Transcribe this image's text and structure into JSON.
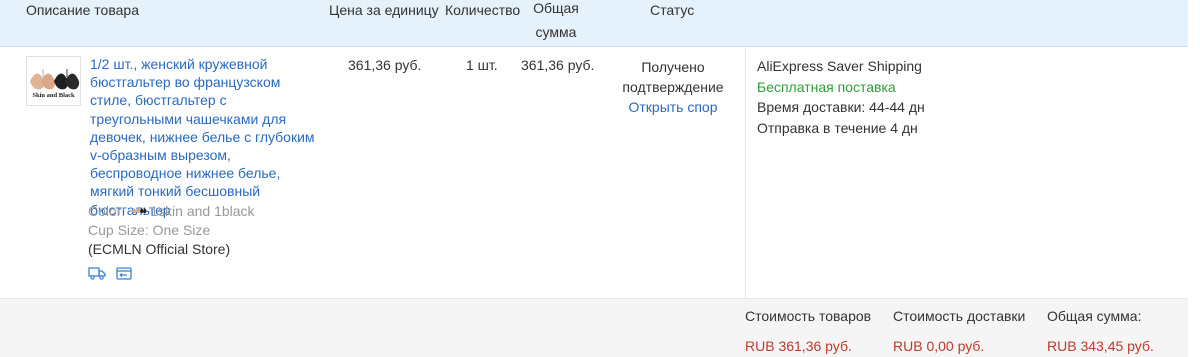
{
  "header": {
    "description": "Описание товара",
    "unit_price": "Цена за единицу",
    "quantity": "Количество",
    "total": "Общая сумма",
    "status": "Статус"
  },
  "product": {
    "thumbnail_brand": "Skin and Black",
    "title": "1/2 шт., женский кружевной бюстгальтер во французском стиле, бюстгальтер с треугольными чашечками для девочек, нижнее белье с глубоким v-образным вырезом, беспроводное нижнее белье, мягкий тонкий бесшовный бюстгальтер",
    "color_label": "Color:",
    "color_value": "1skin and 1black",
    "cup_label": "Cup Size:",
    "cup_value": "One Size",
    "store": "(ECMLN Official Store)",
    "icons": [
      "delivery-truck-icon",
      "store-card-icon"
    ]
  },
  "row": {
    "price": "361,36 руб.",
    "quantity": "1 шт.",
    "total": "361,36 руб.",
    "status_line1": "Получено",
    "status_line2": "подтверждение",
    "dispute_link": "Открыть спор"
  },
  "shipping": {
    "method": "AliExpress Saver Shipping",
    "free": "Бесплатная поставка",
    "delivery_time": "Время доставки: 44-44 дн",
    "dispatch": "Отправка в течение 4 дн"
  },
  "summary": {
    "goods_label": "Стоимость товаров",
    "goods_value": "RUB 361,36 руб.",
    "shipping_label": "Стоимость доставки",
    "shipping_value": "RUB 0,00 руб.",
    "total_label": "Общая сумма:",
    "total_value": "RUB 343,45 руб."
  },
  "colors": {
    "link": "#2a6ac0",
    "free_shipping": "#2e9d3a",
    "price_red": "#c0392b",
    "header_bg": "#e5f1fb"
  }
}
